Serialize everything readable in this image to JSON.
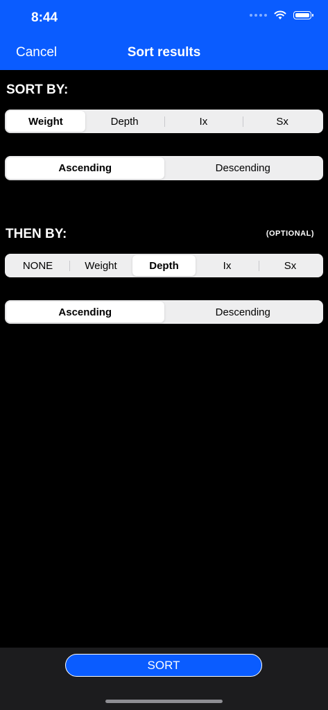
{
  "status_bar": {
    "time": "8:44"
  },
  "nav": {
    "cancel_label": "Cancel",
    "title": "Sort results"
  },
  "sort_by": {
    "label": "SORT BY:",
    "fields": [
      "Weight",
      "Depth",
      "Ix",
      "Sx"
    ],
    "selected_field": "Weight",
    "orders": [
      "Ascending",
      "Descending"
    ],
    "selected_order": "Ascending"
  },
  "then_by": {
    "label": "THEN BY:",
    "optional_label": "(OPTIONAL)",
    "fields": [
      "NONE",
      "Weight",
      "Depth",
      "Ix",
      "Sx"
    ],
    "selected_field": "Depth",
    "orders": [
      "Ascending",
      "Descending"
    ],
    "selected_order": "Ascending"
  },
  "footer": {
    "sort_label": "SORT"
  },
  "colors": {
    "accent": "#0a5cff",
    "background": "#000000"
  }
}
